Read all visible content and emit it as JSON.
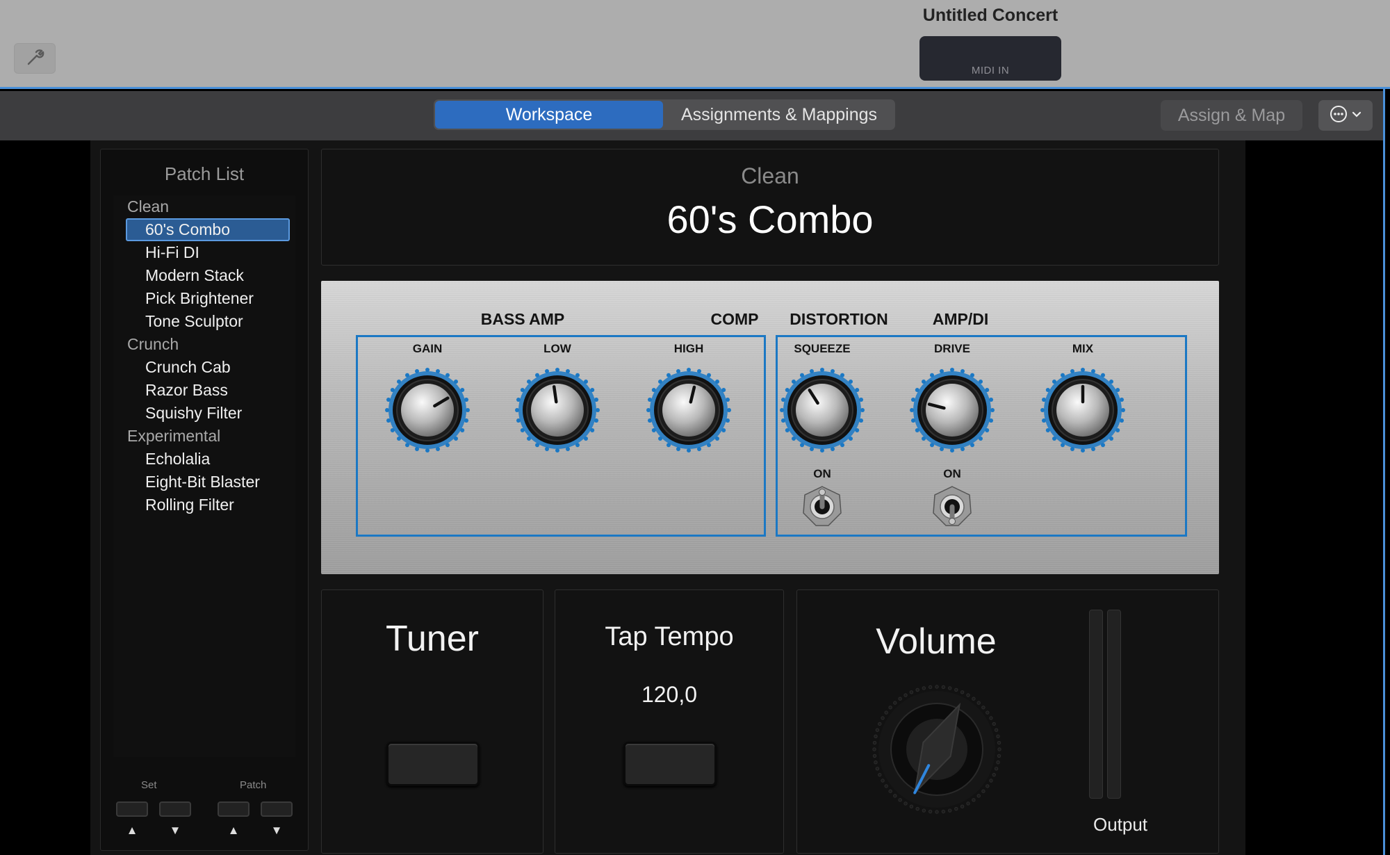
{
  "window": {
    "title": "Untitled Concert",
    "midi_label": "MIDI IN"
  },
  "toolbar": {
    "tabs": [
      {
        "label": "Workspace",
        "selected": true
      },
      {
        "label": "Assignments & Mappings",
        "selected": false
      }
    ],
    "assign_map_label": "Assign & Map",
    "icons": {
      "wrench": "wrench-icon",
      "more": "ellipsis-circle-icon",
      "chevron": "chevron-down-icon"
    }
  },
  "patch_list": {
    "title": "Patch List",
    "groups": [
      {
        "name": "Clean",
        "patches": [
          "60's Combo",
          "Hi-Fi DI",
          "Modern Stack",
          "Pick Brightener",
          "Tone Sculptor"
        ]
      },
      {
        "name": "Crunch",
        "patches": [
          "Crunch Cab",
          "Razor Bass",
          "Squishy Filter"
        ]
      },
      {
        "name": "Experimental",
        "patches": [
          "Echolalia",
          "Eight-Bit Blaster",
          "Rolling Filter"
        ]
      }
    ],
    "selected_patch": "60's Combo",
    "set_label": "Set",
    "patch_label": "Patch",
    "arrows": {
      "up": "▲",
      "down": "▼"
    }
  },
  "header": {
    "category": "Clean",
    "patch_name": "60's Combo"
  },
  "amp": {
    "sections": {
      "bass_amp": "BASS AMP",
      "comp": "COMP",
      "distortion": "DISTORTION",
      "amp_di": "AMP/DI"
    },
    "knobs": [
      {
        "label": "GAIN",
        "value": 0.72
      },
      {
        "label": "LOW",
        "value": 0.47
      },
      {
        "label": "HIGH",
        "value": 0.55
      },
      {
        "label": "SQUEEZE",
        "value": 0.38
      },
      {
        "label": "DRIVE",
        "value": 0.22
      },
      {
        "label": "MIX",
        "value": 0.5
      }
    ],
    "toggles": [
      {
        "label": "ON",
        "state": "up"
      },
      {
        "label": "ON",
        "state": "down"
      }
    ],
    "accent_color": "#1b78c4"
  },
  "tuner": {
    "title": "Tuner"
  },
  "tap_tempo": {
    "title": "Tap Tempo",
    "value": "120,0"
  },
  "volume": {
    "title": "Volume",
    "output_label": "Output",
    "knob_value": 0.6
  }
}
